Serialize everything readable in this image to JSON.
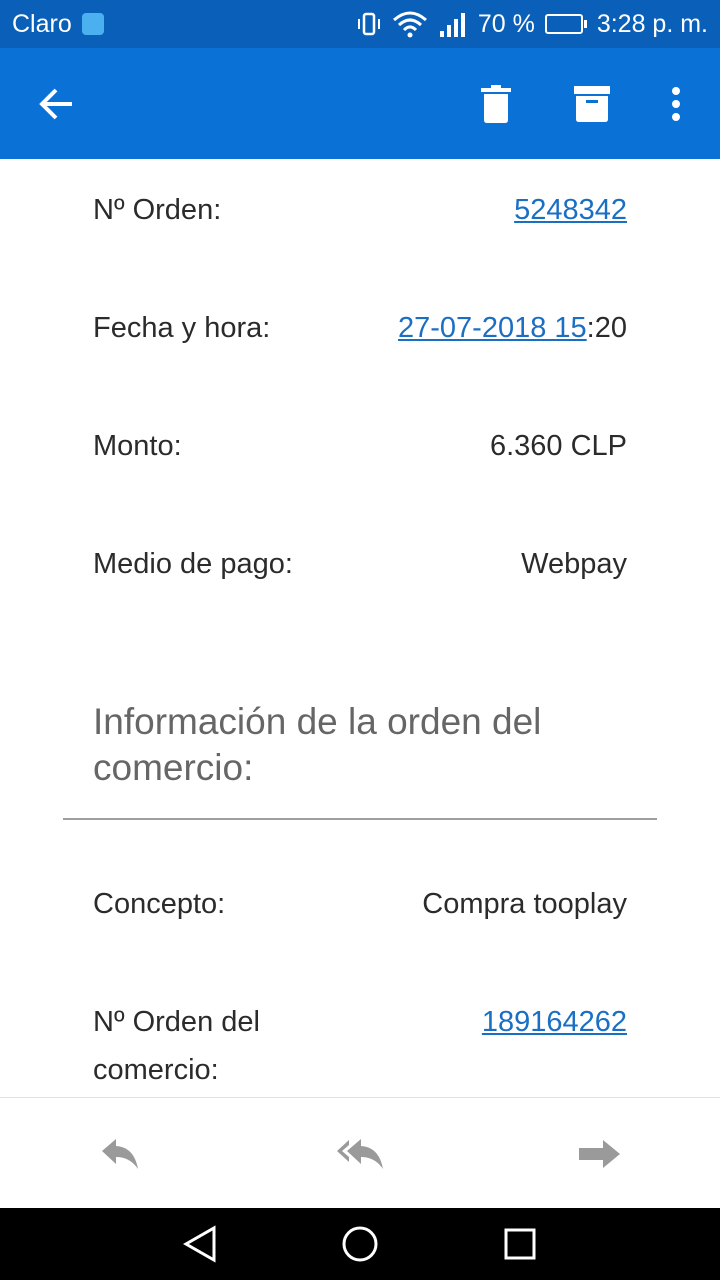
{
  "status_bar": {
    "carrier": "Claro",
    "battery_percent": "70 %",
    "battery_level": 0.7,
    "time": "3:28 p. m.",
    "icons": [
      "notification-app-icon",
      "vibrate-icon",
      "wifi-icon",
      "signal-icon",
      "battery-icon"
    ]
  },
  "app_bar": {
    "icons": [
      "back-arrow-icon",
      "trash-icon",
      "archive-icon",
      "more-vert-icon"
    ],
    "color": "#0a71d6"
  },
  "order": {
    "rows": [
      {
        "label": "Nº Orden:",
        "value": "5248342"
      },
      {
        "label": "Fecha y hora:",
        "value_link": "27-07-2018 15",
        "value_rest": ":20"
      },
      {
        "label": "Monto:",
        "value": "6.360 CLP"
      },
      {
        "label": "Medio de pago:",
        "value": "Webpay"
      }
    ]
  },
  "merchant": {
    "section_title": "Información de la orden del comercio:",
    "rows": [
      {
        "label": "Concepto:",
        "value": "Compra tooplay"
      },
      {
        "label_line1": "Nº Orden del",
        "label_line2": "comercio:",
        "value": "189164262"
      }
    ]
  },
  "actions": {
    "icons": [
      "reply-icon",
      "reply-all-icon",
      "forward-icon"
    ]
  },
  "nav": {
    "icons": [
      "nav-back-icon",
      "nav-home-icon",
      "nav-recents-icon"
    ]
  },
  "colors": {
    "status_bar": "#0a5fb8",
    "link": "#1a6fc4",
    "section_title": "#666666",
    "action_icon": "#9a9a9a"
  }
}
